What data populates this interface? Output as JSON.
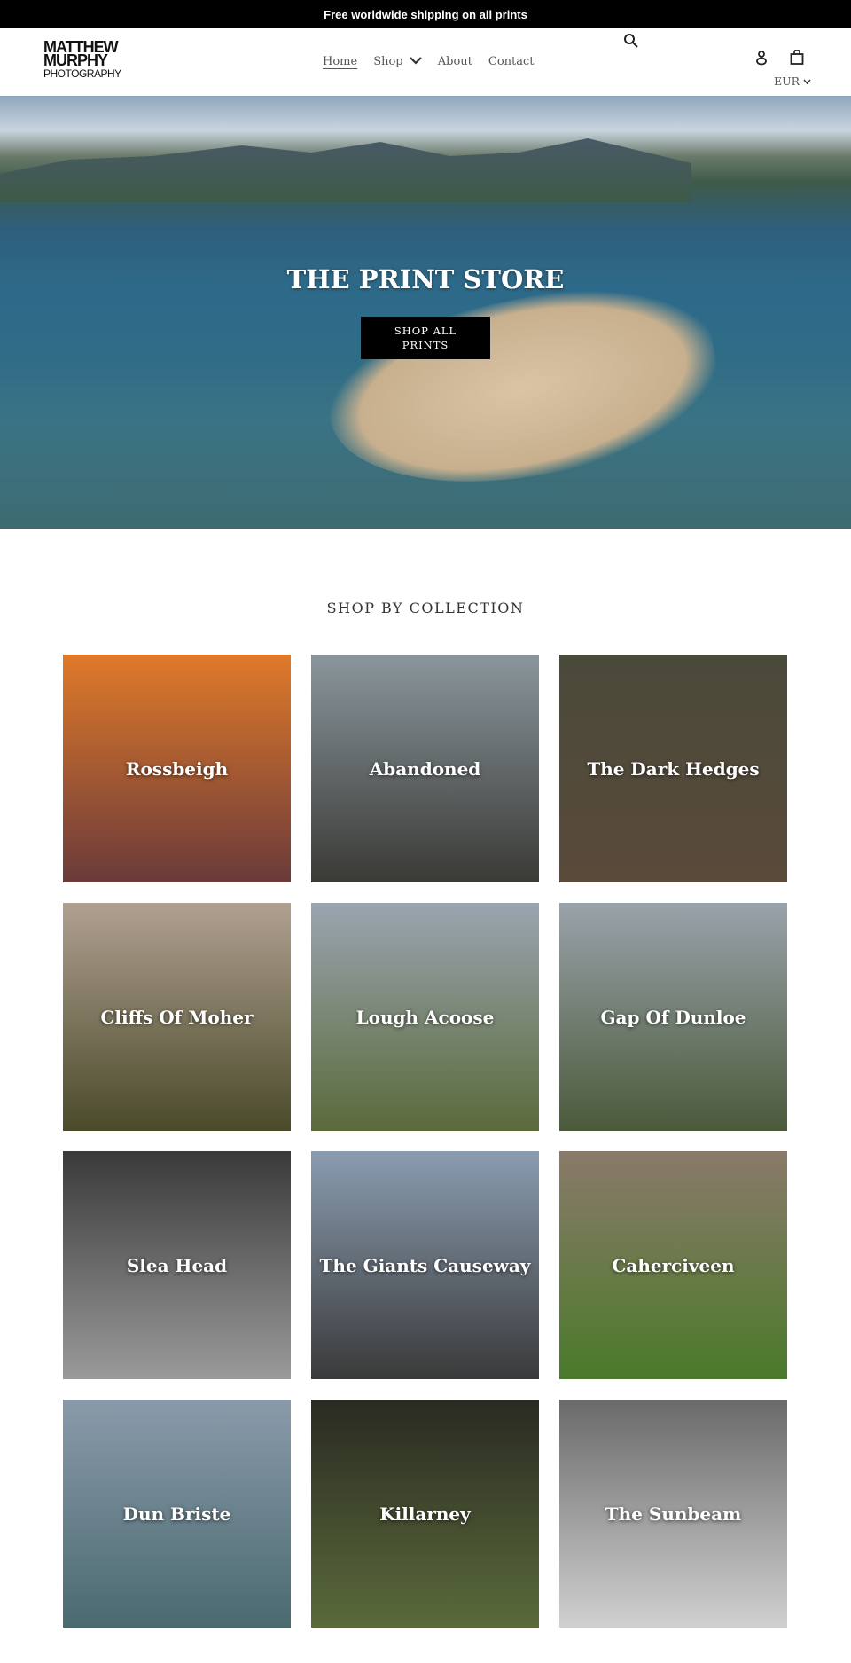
{
  "announcement": "Free worldwide shipping on all prints",
  "logo": {
    "line1": "MATTHEW",
    "line2": "MURPHY",
    "line3": "PHOTOGRAPHY"
  },
  "nav": [
    {
      "label": "Home",
      "active": true
    },
    {
      "label": "Shop"
    },
    {
      "label": "About"
    },
    {
      "label": "Contact"
    }
  ],
  "icons": {
    "search": "search-icon",
    "account": "user-icon",
    "cart": "cart-icon",
    "chevron": "chevron-down-icon"
  },
  "currency": "EUR",
  "hero": {
    "title": "THE PRINT STORE",
    "button": "SHOP ALL PRINTS"
  },
  "section_title": "SHOP BY COLLECTION",
  "collections": [
    {
      "name": "Rossbeigh",
      "colors": [
        "#e07a2a",
        "#6a3a3a"
      ]
    },
    {
      "name": "Abandoned",
      "colors": [
        "#8a969c",
        "#3a3a36"
      ]
    },
    {
      "name": "The Dark Hedges",
      "colors": [
        "#4a4a3a",
        "#5a4a3a"
      ]
    },
    {
      "name": "Cliffs Of Moher",
      "colors": [
        "#b0a090",
        "#4a4a2a"
      ]
    },
    {
      "name": "Lough Acoose",
      "colors": [
        "#9aa4b0",
        "#5a6a3a"
      ]
    },
    {
      "name": "Gap Of Dunloe",
      "colors": [
        "#9aa2aa",
        "#4a5a3a"
      ]
    },
    {
      "name": "Slea Head",
      "colors": [
        "#3a3a3a",
        "#9a9a9a"
      ]
    },
    {
      "name": "The Giants Causeway",
      "colors": [
        "#8a9cb0",
        "#3a3a3a"
      ]
    },
    {
      "name": "Caherciveen",
      "colors": [
        "#8a7a6a",
        "#4a7a2a"
      ]
    },
    {
      "name": "Dun Briste",
      "colors": [
        "#8a9aaa",
        "#4a6a70"
      ]
    },
    {
      "name": "Killarney",
      "colors": [
        "#2a2a22",
        "#5a6a3a"
      ]
    },
    {
      "name": "The Sunbeam",
      "colors": [
        "#6a6a6a",
        "#d0d0d0"
      ]
    }
  ]
}
